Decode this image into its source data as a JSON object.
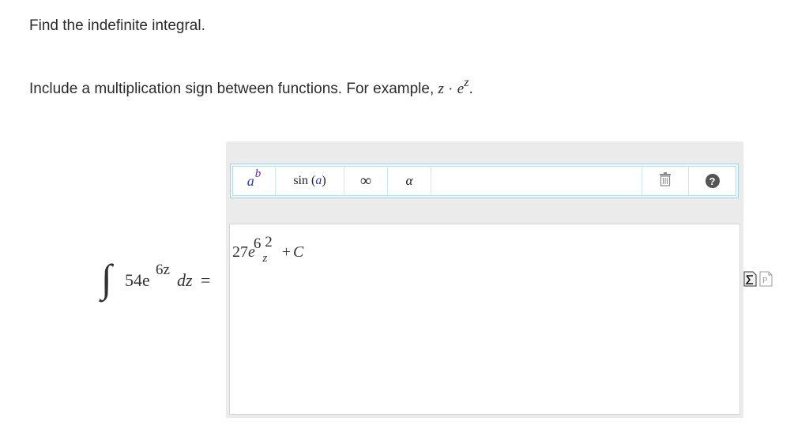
{
  "instructions": {
    "line1": "Find the indefinite integral.",
    "line2_prefix": "Include a multiplication sign between functions. For example, ",
    "example_z": "z",
    "example_dot": " · ",
    "example_e": "e",
    "example_sup": "z",
    "example_end": "."
  },
  "equation": {
    "integral": "∫",
    "coefficient": "54e",
    "exponent": "6z",
    "differential": "dz",
    "equals": "="
  },
  "toolbar": {
    "power_base": "a",
    "power_exp": "b",
    "sin_label": "sin (",
    "sin_arg": "a",
    "sin_close": ")",
    "infinity": "∞",
    "alpha": "α",
    "help": "?"
  },
  "answer": {
    "coef": "27",
    "e": "e",
    "sup6": "6",
    "z": "z",
    "sup2": "2",
    "plus": "+",
    "c": "C"
  }
}
